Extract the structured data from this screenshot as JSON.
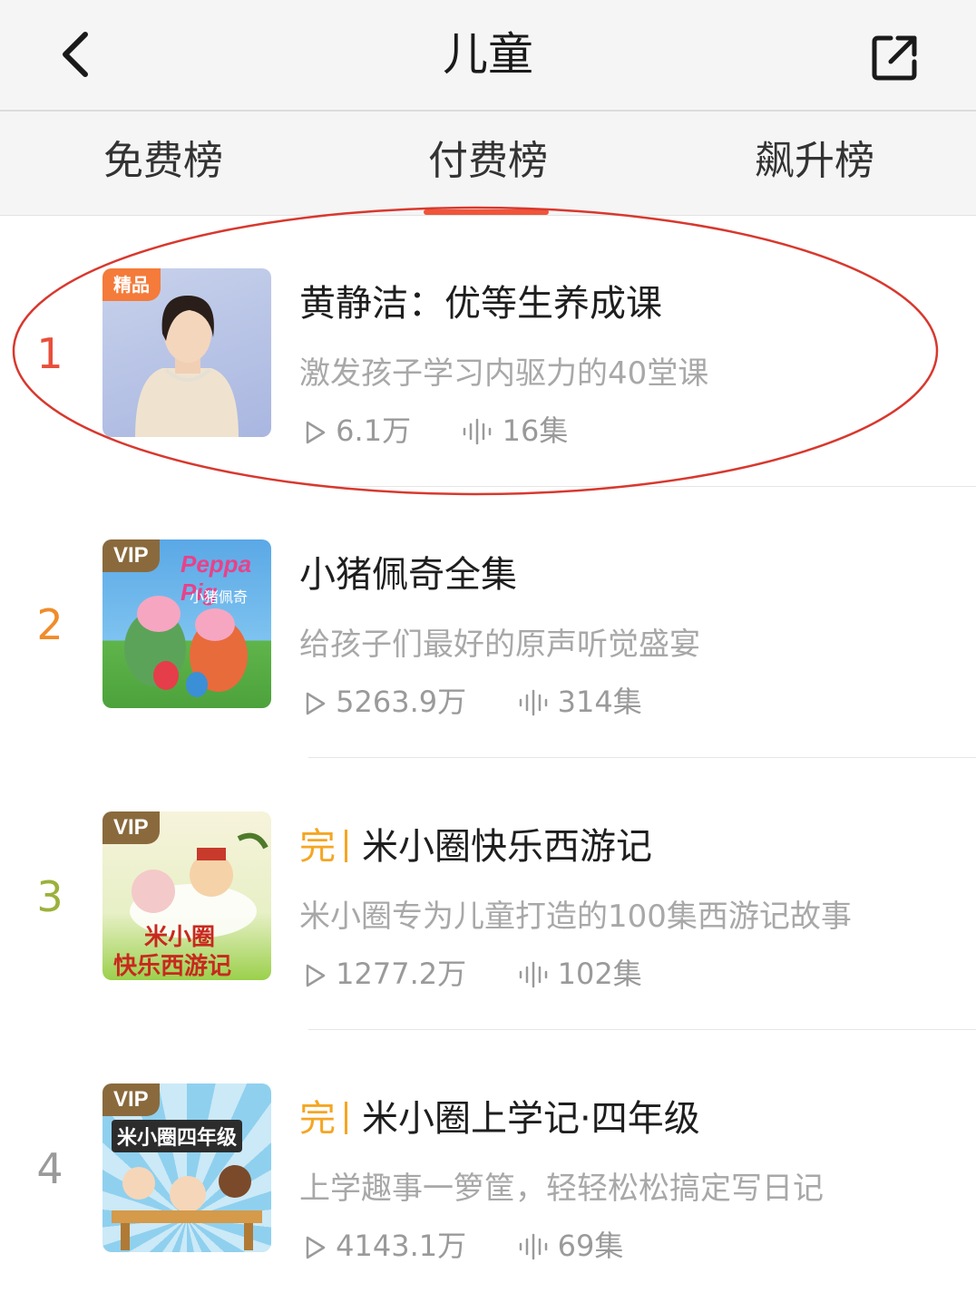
{
  "header": {
    "title": "儿童"
  },
  "tabs": [
    {
      "label": "免费榜"
    },
    {
      "label": "付费榜"
    },
    {
      "label": "飙升榜"
    }
  ],
  "colors": {
    "accent": "#f0553a",
    "rank1": "#e84f3b",
    "rank2": "#f08c2a",
    "rank3": "#9bb13a",
    "rank4": "#9a9a9a",
    "completed": "#f5a623"
  },
  "items": [
    {
      "rank": "1",
      "badge": "精品",
      "title": "黄静洁：优等生养成课",
      "description": "激发孩子学习内驱力的40堂课",
      "plays": "6.1万",
      "episodes": "16集"
    },
    {
      "rank": "2",
      "badge": "VIP",
      "title": "小猪佩奇全集",
      "description": "给孩子们最好的原声听觉盛宴",
      "plays": "5263.9万",
      "episodes": "314集",
      "cover_text": "Peppa Pig",
      "cover_subtext": "小猪佩奇"
    },
    {
      "rank": "3",
      "badge": "VIP",
      "status": "完",
      "title": "米小圈快乐西游记",
      "description": "米小圈专为儿童打造的100集西游记故事",
      "plays": "1277.2万",
      "episodes": "102集",
      "cover_text": "米小圈",
      "cover_subtext": "快乐西游记"
    },
    {
      "rank": "4",
      "badge": "VIP",
      "status": "完",
      "title": "米小圈上学记·四年级",
      "description": "上学趣事一箩筐，轻轻松松搞定写日记",
      "plays": "4143.1万",
      "episodes": "69集",
      "cover_text": "米小圈四年级"
    }
  ]
}
